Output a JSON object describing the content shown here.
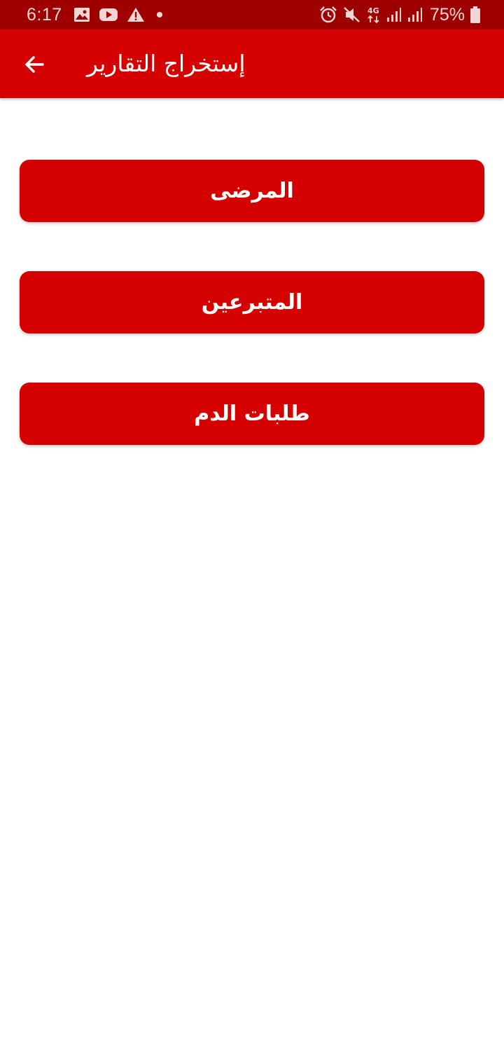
{
  "status_bar": {
    "time": "6:17",
    "battery_percent": "75%",
    "network_type": "4G",
    "left_icons": [
      "gallery-icon",
      "youtube-icon",
      "warning-icon",
      "notification-dot-icon"
    ],
    "right_icons": [
      "alarm-icon",
      "mute-icon",
      "network-4g-icon",
      "signal-icon",
      "signal-icon",
      "battery-icon"
    ],
    "background_color": "#9e0000"
  },
  "app_bar": {
    "title": "إستخراج التقارير",
    "back_icon": "arrow-left-icon",
    "background_color": "#d50000"
  },
  "reports": [
    {
      "label": "المرضى"
    },
    {
      "label": "المتبرعين"
    },
    {
      "label": "طلبات الدم"
    }
  ],
  "colors": {
    "primary": "#d50000",
    "primary_dark": "#9e0000",
    "on_primary": "#ffffff",
    "background": "#ffffff"
  }
}
